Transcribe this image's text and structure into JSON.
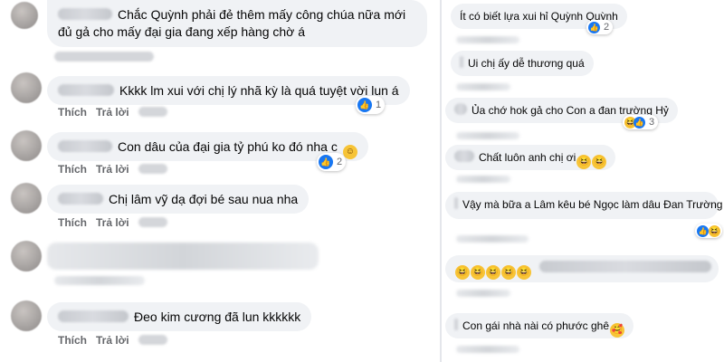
{
  "left_comments": [
    {
      "text": "Chắc Quỳnh phải đẻ thêm mấy công chúa nữa mới đủ gả cho mấy đại gia đang xếp hàng chờ á"
    },
    {
      "text": "Kkkk lm xui với chị lý nhã kỳ là quá tuyệt vời lun á",
      "likes": "1"
    },
    {
      "text": "Con dâu của đại gia tỷ phú ko đó nha c",
      "likes": "2"
    },
    {
      "text": "Chị lâm vỹ dạ đợi bé sau nua nha"
    },
    {
      "text": "Đeo kim cương đã lun kkkkkk"
    }
  ],
  "action_like": "Thích",
  "action_reply": "Trả lời",
  "right_comments": [
    {
      "text": "Ít có biết lựa xui hỉ Quỳnh Quỳnh",
      "likes": "2"
    },
    {
      "text": "Ui chị ấy dễ thương quá"
    },
    {
      "text": "Ủa chớ hok gả cho Con a đan trường Hỷ",
      "likes": "3"
    },
    {
      "text": "Chất luôn anh chị ơi"
    },
    {
      "text": "Vậy mà bữa a Lâm kêu bé Ngọc làm dâu Đan Trường"
    },
    {
      "text": "Con gái nhà nài có phước ghê"
    }
  ],
  "colors": {
    "bubble": "#f0f2f5",
    "like_blue": "#1877f2",
    "meta_gray": "#65676b"
  }
}
